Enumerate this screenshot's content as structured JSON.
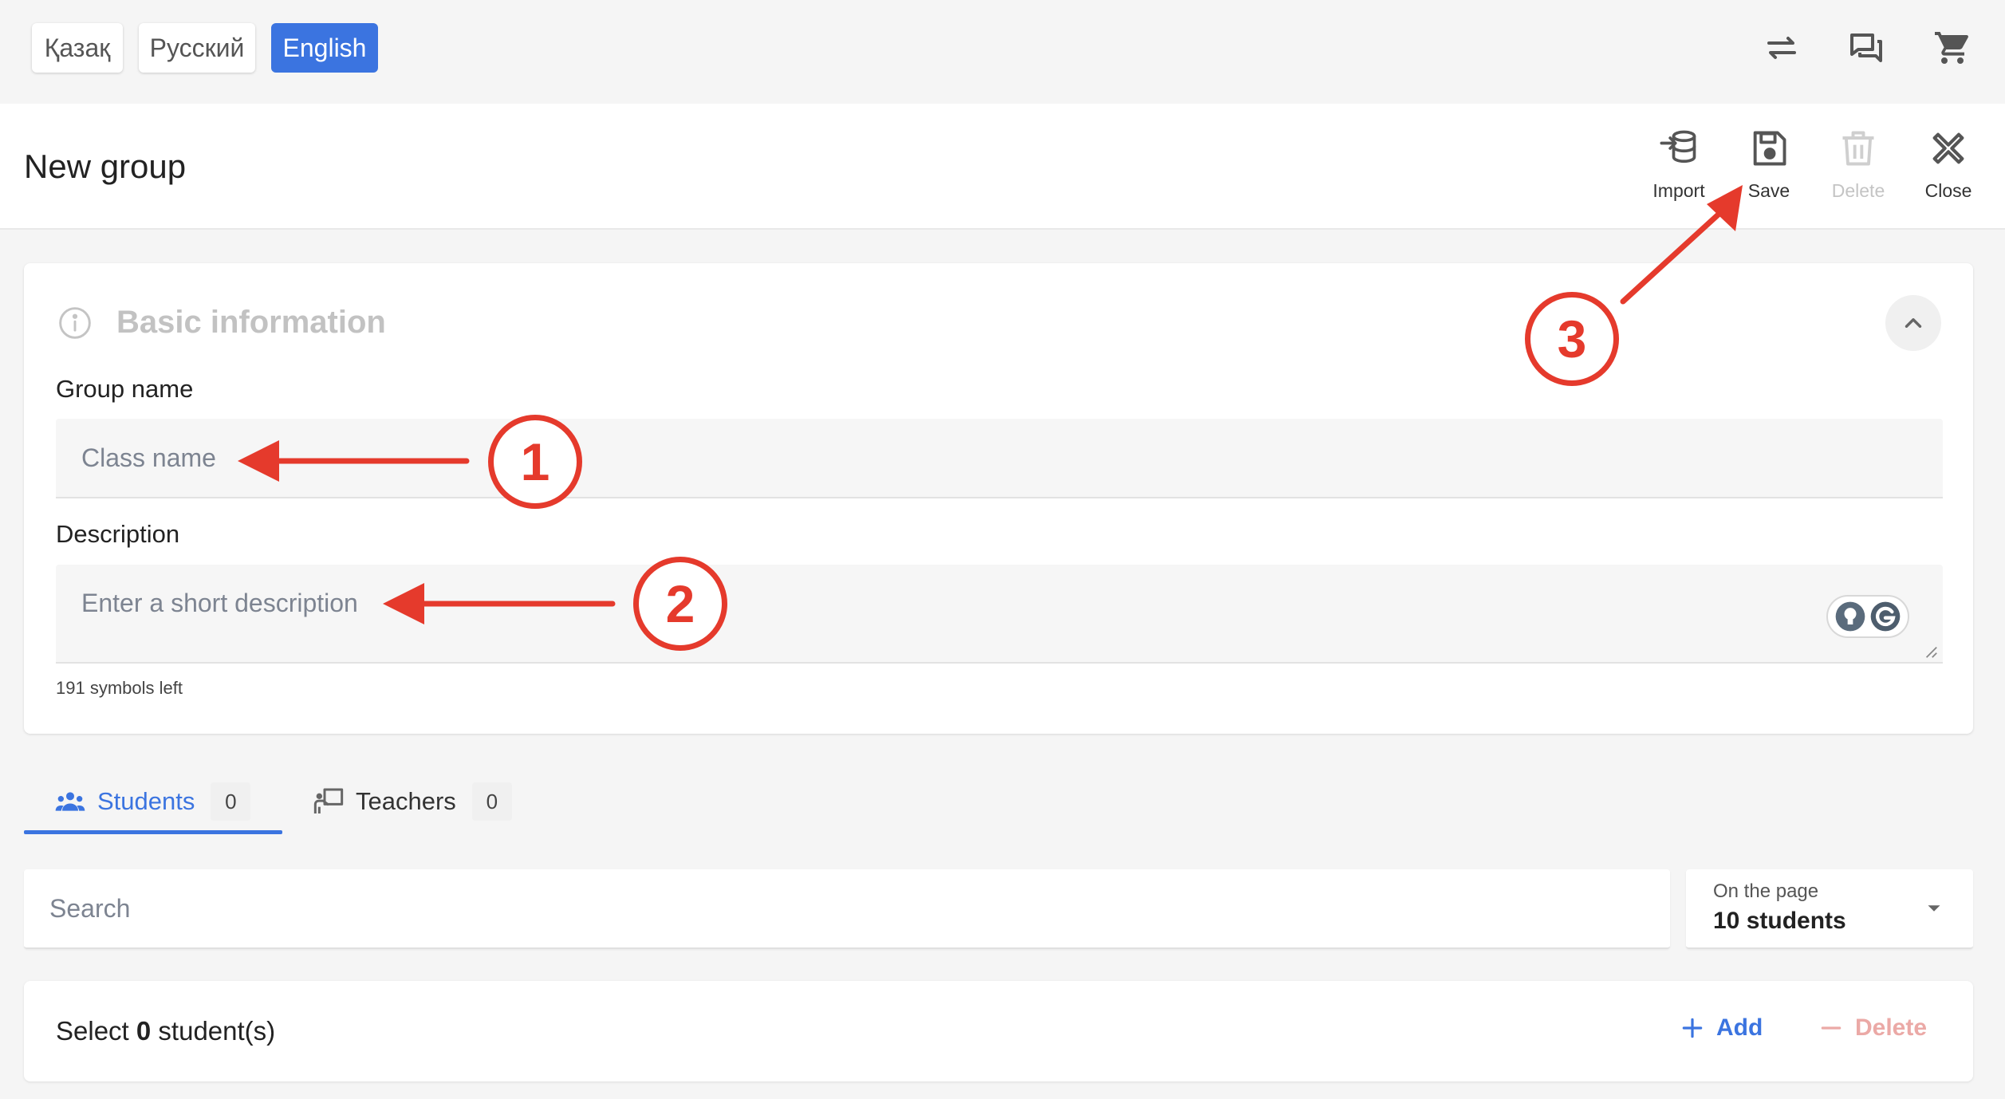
{
  "languages": [
    {
      "label": "Қазақ",
      "active": false
    },
    {
      "label": "Русский",
      "active": false
    },
    {
      "label": "English",
      "active": true
    }
  ],
  "top_icons": [
    "swap-icon",
    "chat-icon",
    "cart-icon"
  ],
  "header": {
    "title": "New group",
    "tools": {
      "import": "Import",
      "save": "Save",
      "delete": "Delete",
      "close": "Close"
    }
  },
  "basic_info": {
    "title": "Basic information",
    "group_name_label": "Group name",
    "group_name_placeholder": "Class name",
    "description_label": "Description",
    "description_placeholder": "Enter a short description",
    "symbols_left": "191 symbols left"
  },
  "tabs": [
    {
      "label": "Students",
      "count": "0",
      "active": true
    },
    {
      "label": "Teachers",
      "count": "0",
      "active": false
    }
  ],
  "search": {
    "placeholder": "Search"
  },
  "page_size": {
    "label": "On the page",
    "value": "10 students"
  },
  "select_bar": {
    "prefix": "Select",
    "count": "0",
    "suffix": "student(s)",
    "add_label": "Add",
    "delete_label": "Delete"
  },
  "annotations": {
    "one": "1",
    "two": "2",
    "three": "3"
  },
  "colors": {
    "accent": "#3b74e0",
    "annotation": "#e53a2c",
    "danger_muted": "#eba9a6"
  }
}
